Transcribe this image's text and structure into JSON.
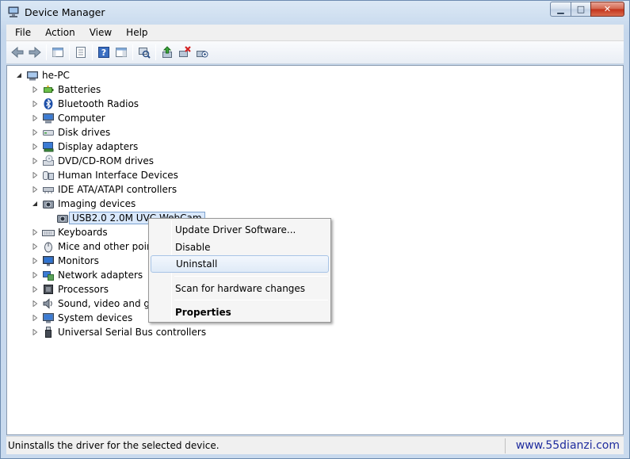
{
  "window": {
    "title": "Device Manager",
    "buttons": {
      "minimize": "▁",
      "maximize": "□",
      "close": "✕"
    }
  },
  "menu": [
    "File",
    "Action",
    "View",
    "Help"
  ],
  "toolbar": [
    "back-icon",
    "forward-icon",
    "show-hide-console-tree-icon",
    "properties-icon",
    "help-icon",
    "show-action-pane-icon",
    "scan-hardware-icon",
    "update-driver-icon",
    "uninstall-icon",
    "disable-icon"
  ],
  "tree": {
    "root": "he-PC",
    "categories": [
      {
        "label": "Batteries",
        "icon": "battery-icon"
      },
      {
        "label": "Bluetooth Radios",
        "icon": "bluetooth-icon"
      },
      {
        "label": "Computer",
        "icon": "computer-icon"
      },
      {
        "label": "Disk drives",
        "icon": "disk-drive-icon"
      },
      {
        "label": "Display adapters",
        "icon": "display-adapter-icon"
      },
      {
        "label": "DVD/CD-ROM drives",
        "icon": "dvd-drive-icon"
      },
      {
        "label": "Human Interface Devices",
        "icon": "hid-icon"
      },
      {
        "label": "IDE ATA/ATAPI controllers",
        "icon": "ide-controller-icon"
      },
      {
        "label": "Imaging devices",
        "icon": "camera-icon"
      },
      {
        "label": "Keyboards",
        "icon": "keyboard-icon"
      },
      {
        "label": "Mice and other pointi",
        "icon": "mouse-icon"
      },
      {
        "label": "Monitors",
        "icon": "monitor-icon"
      },
      {
        "label": "Network adapters",
        "icon": "network-adapter-icon"
      },
      {
        "label": "Processors",
        "icon": "processor-icon"
      },
      {
        "label": "Sound, video and gar",
        "icon": "speaker-icon"
      },
      {
        "label": "System devices",
        "icon": "system-devices-icon"
      },
      {
        "label": "Universal Serial Bus controllers",
        "icon": "usb-icon"
      }
    ],
    "imaging_child": "USB2.0 2.0M UVC WebCam"
  },
  "context_menu": {
    "update": "Update Driver Software...",
    "disable": "Disable",
    "uninstall": "Uninstall",
    "scan": "Scan for hardware changes",
    "properties": "Properties"
  },
  "status": {
    "text": "Uninstalls the driver for the selected device.",
    "watermark": "www.55dianzi.com"
  },
  "colors": {
    "selection_bg": "#d9e8fb",
    "selection_border": "#7da2ce",
    "watermark": "#1f2c9e"
  }
}
